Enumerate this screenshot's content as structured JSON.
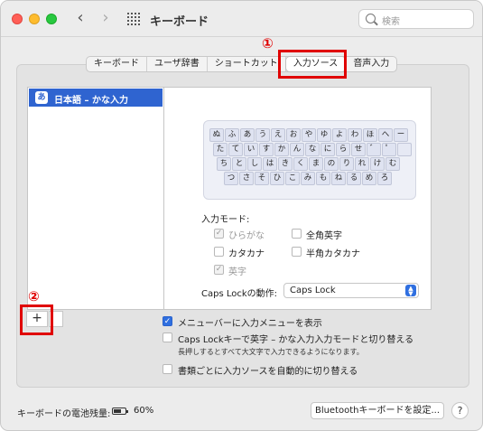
{
  "titlebar": {
    "title": "キーボード",
    "nav_back": "‹",
    "nav_forward": "›",
    "search_placeholder": "検索"
  },
  "tabs": [
    {
      "label": "キーボード",
      "active": false
    },
    {
      "label": "ユーザ辞書",
      "active": false
    },
    {
      "label": "ショートカット",
      "active": false
    },
    {
      "label": "入力ソース",
      "active": true
    },
    {
      "label": "音声入力",
      "active": false
    }
  ],
  "annotations": {
    "one": "①",
    "two": "②"
  },
  "sources": {
    "items": [
      {
        "icon_text": "あ",
        "label": "日本語 – かな入力",
        "selected": true
      }
    ],
    "add_label": "+",
    "remove_label": ""
  },
  "keyboard_layout": {
    "rows": [
      [
        "ぬ",
        "ふ",
        "あ",
        "う",
        "え",
        "お",
        "や",
        "ゆ",
        "よ",
        "わ",
        "ほ",
        "へ",
        "ー"
      ],
      [
        "た",
        "て",
        "い",
        "す",
        "か",
        "ん",
        "な",
        "に",
        "ら",
        "せ",
        "゛",
        "゜",
        ""
      ],
      [
        "ち",
        "と",
        "し",
        "は",
        "き",
        "く",
        "ま",
        "の",
        "り",
        "れ",
        "け",
        "む"
      ],
      [
        "つ",
        "さ",
        "そ",
        "ひ",
        "こ",
        "み",
        "も",
        "ね",
        "る",
        "め",
        "ろ"
      ]
    ]
  },
  "input_mode": {
    "label": "入力モード:",
    "options": [
      {
        "label": "ひらがな",
        "checked": true,
        "disabled": true
      },
      {
        "label": "全角英字",
        "checked": false,
        "disabled": false
      },
      {
        "label": "カタカナ",
        "checked": false,
        "disabled": false
      },
      {
        "label": "半角カタカナ",
        "checked": false,
        "disabled": false
      },
      {
        "label": "英字",
        "checked": true,
        "disabled": true
      }
    ]
  },
  "caps_lock": {
    "label": "Caps Lockの動作:",
    "selected": "Caps Lock"
  },
  "options": {
    "show_menu": {
      "label": "メニューバーに入力メニューを表示",
      "checked": true
    },
    "caps_switch": {
      "label": "Caps Lockキーで英字 – かな入力入力モードと切り替える",
      "checked": false,
      "sub": "長押しするとすべて大文字で入力できるようになります。"
    },
    "auto_switch": {
      "label": "書類ごとに入力ソースを自動的に切り替える",
      "checked": false
    }
  },
  "footer": {
    "battery_label": "キーボードの電池残量:",
    "battery_value": "60%",
    "battery_level": 0.6,
    "bluetooth_button": "Bluetoothキーボードを設定...",
    "help": "?"
  },
  "colors": {
    "accent": "#2f6fe0",
    "selection": "#2f64d0",
    "annotation": "#e00000"
  }
}
